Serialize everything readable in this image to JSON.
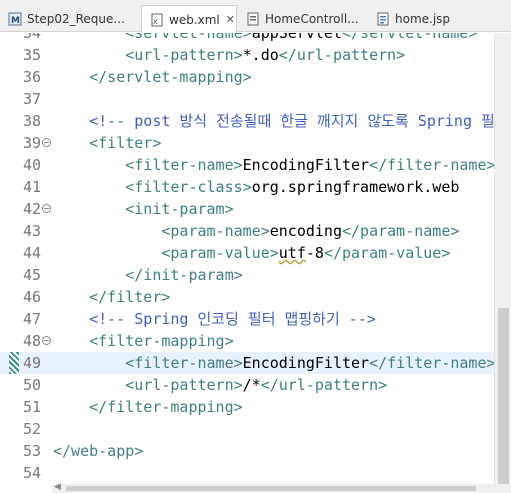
{
  "tabs": [
    {
      "label": "Step02_Reque...",
      "icon": "web-page-icon",
      "active": false
    },
    {
      "label": "web.xml",
      "icon": "xml-file-icon",
      "active": true,
      "close": "✕"
    },
    {
      "label": "HomeControll...",
      "icon": "java-class-icon",
      "active": false
    },
    {
      "label": "home.jsp",
      "icon": "jsp-file-icon",
      "active": false
    }
  ],
  "editor": {
    "lines": [
      {
        "n": "34",
        "segs": [
          [
            "tag",
            "        <servlet-name>"
          ],
          [
            "txt",
            "appServlet"
          ],
          [
            "tag",
            "</servlet-name>"
          ]
        ]
      },
      {
        "n": "35",
        "segs": [
          [
            "tag",
            "        <url-pattern>"
          ],
          [
            "txt",
            "*.do"
          ],
          [
            "tag",
            "</url-pattern>"
          ]
        ]
      },
      {
        "n": "36",
        "segs": [
          [
            "tag",
            "    </servlet-mapping>"
          ]
        ]
      },
      {
        "n": "37",
        "segs": []
      },
      {
        "n": "38",
        "segs": [
          [
            "cmt",
            "    <!-- post 방식 전송될때 한글 깨지지 않도록 Spring 필터"
          ]
        ]
      },
      {
        "n": "39",
        "fold": "−",
        "segs": [
          [
            "tag",
            "    <filter>"
          ]
        ]
      },
      {
        "n": "40",
        "segs": [
          [
            "tag",
            "        <filter-name>"
          ],
          [
            "txt",
            "EncodingFilter"
          ],
          [
            "tag",
            "</filter-name>"
          ]
        ]
      },
      {
        "n": "41",
        "segs": [
          [
            "tag",
            "        <filter-class>"
          ],
          [
            "txt",
            "org.springframework.web"
          ]
        ]
      },
      {
        "n": "42",
        "fold": "−",
        "segs": [
          [
            "tag",
            "        <init-param>"
          ]
        ]
      },
      {
        "n": "43",
        "segs": [
          [
            "tag",
            "            <param-name>"
          ],
          [
            "txt",
            "encoding"
          ],
          [
            "tag",
            "</param-name>"
          ]
        ]
      },
      {
        "n": "44",
        "segs": [
          [
            "tag",
            "            <param-value>"
          ],
          [
            "sq",
            "utf"
          ],
          [
            "txt",
            "-8"
          ],
          [
            "tag",
            "</param-value>"
          ]
        ]
      },
      {
        "n": "45",
        "segs": [
          [
            "tag",
            "        </init-param>"
          ]
        ]
      },
      {
        "n": "46",
        "segs": [
          [
            "tag",
            "    </filter>"
          ]
        ]
      },
      {
        "n": "47",
        "segs": [
          [
            "cmt",
            "    <!-- Spring 인코딩 필터 맵핑하기 -->"
          ]
        ]
      },
      {
        "n": "48",
        "fold": "−",
        "segs": [
          [
            "tag",
            "    <filter-mapping>"
          ]
        ]
      },
      {
        "n": "49",
        "current": true,
        "segs": [
          [
            "tag",
            "        <filter-name>"
          ],
          [
            "txt",
            "EncodingFilter"
          ],
          [
            "tag",
            "</filter-name>"
          ]
        ]
      },
      {
        "n": "50",
        "segs": [
          [
            "tag",
            "        <url-pattern>"
          ],
          [
            "txt",
            "/*"
          ],
          [
            "tag",
            "</url-pattern>"
          ]
        ]
      },
      {
        "n": "51",
        "segs": [
          [
            "tag",
            "    </filter-mapping>"
          ]
        ]
      },
      {
        "n": "52",
        "segs": []
      },
      {
        "n": "53",
        "segs": [
          [
            "tag",
            "</web-app>"
          ]
        ]
      },
      {
        "n": "54",
        "segs": []
      }
    ]
  },
  "colors": {
    "tag": "#3f7f7f",
    "comment": "#3f5fbf",
    "text": "#000000",
    "current_line": "#e8f2fe"
  },
  "scrollbar": {
    "h_left_arrow": "◀"
  }
}
